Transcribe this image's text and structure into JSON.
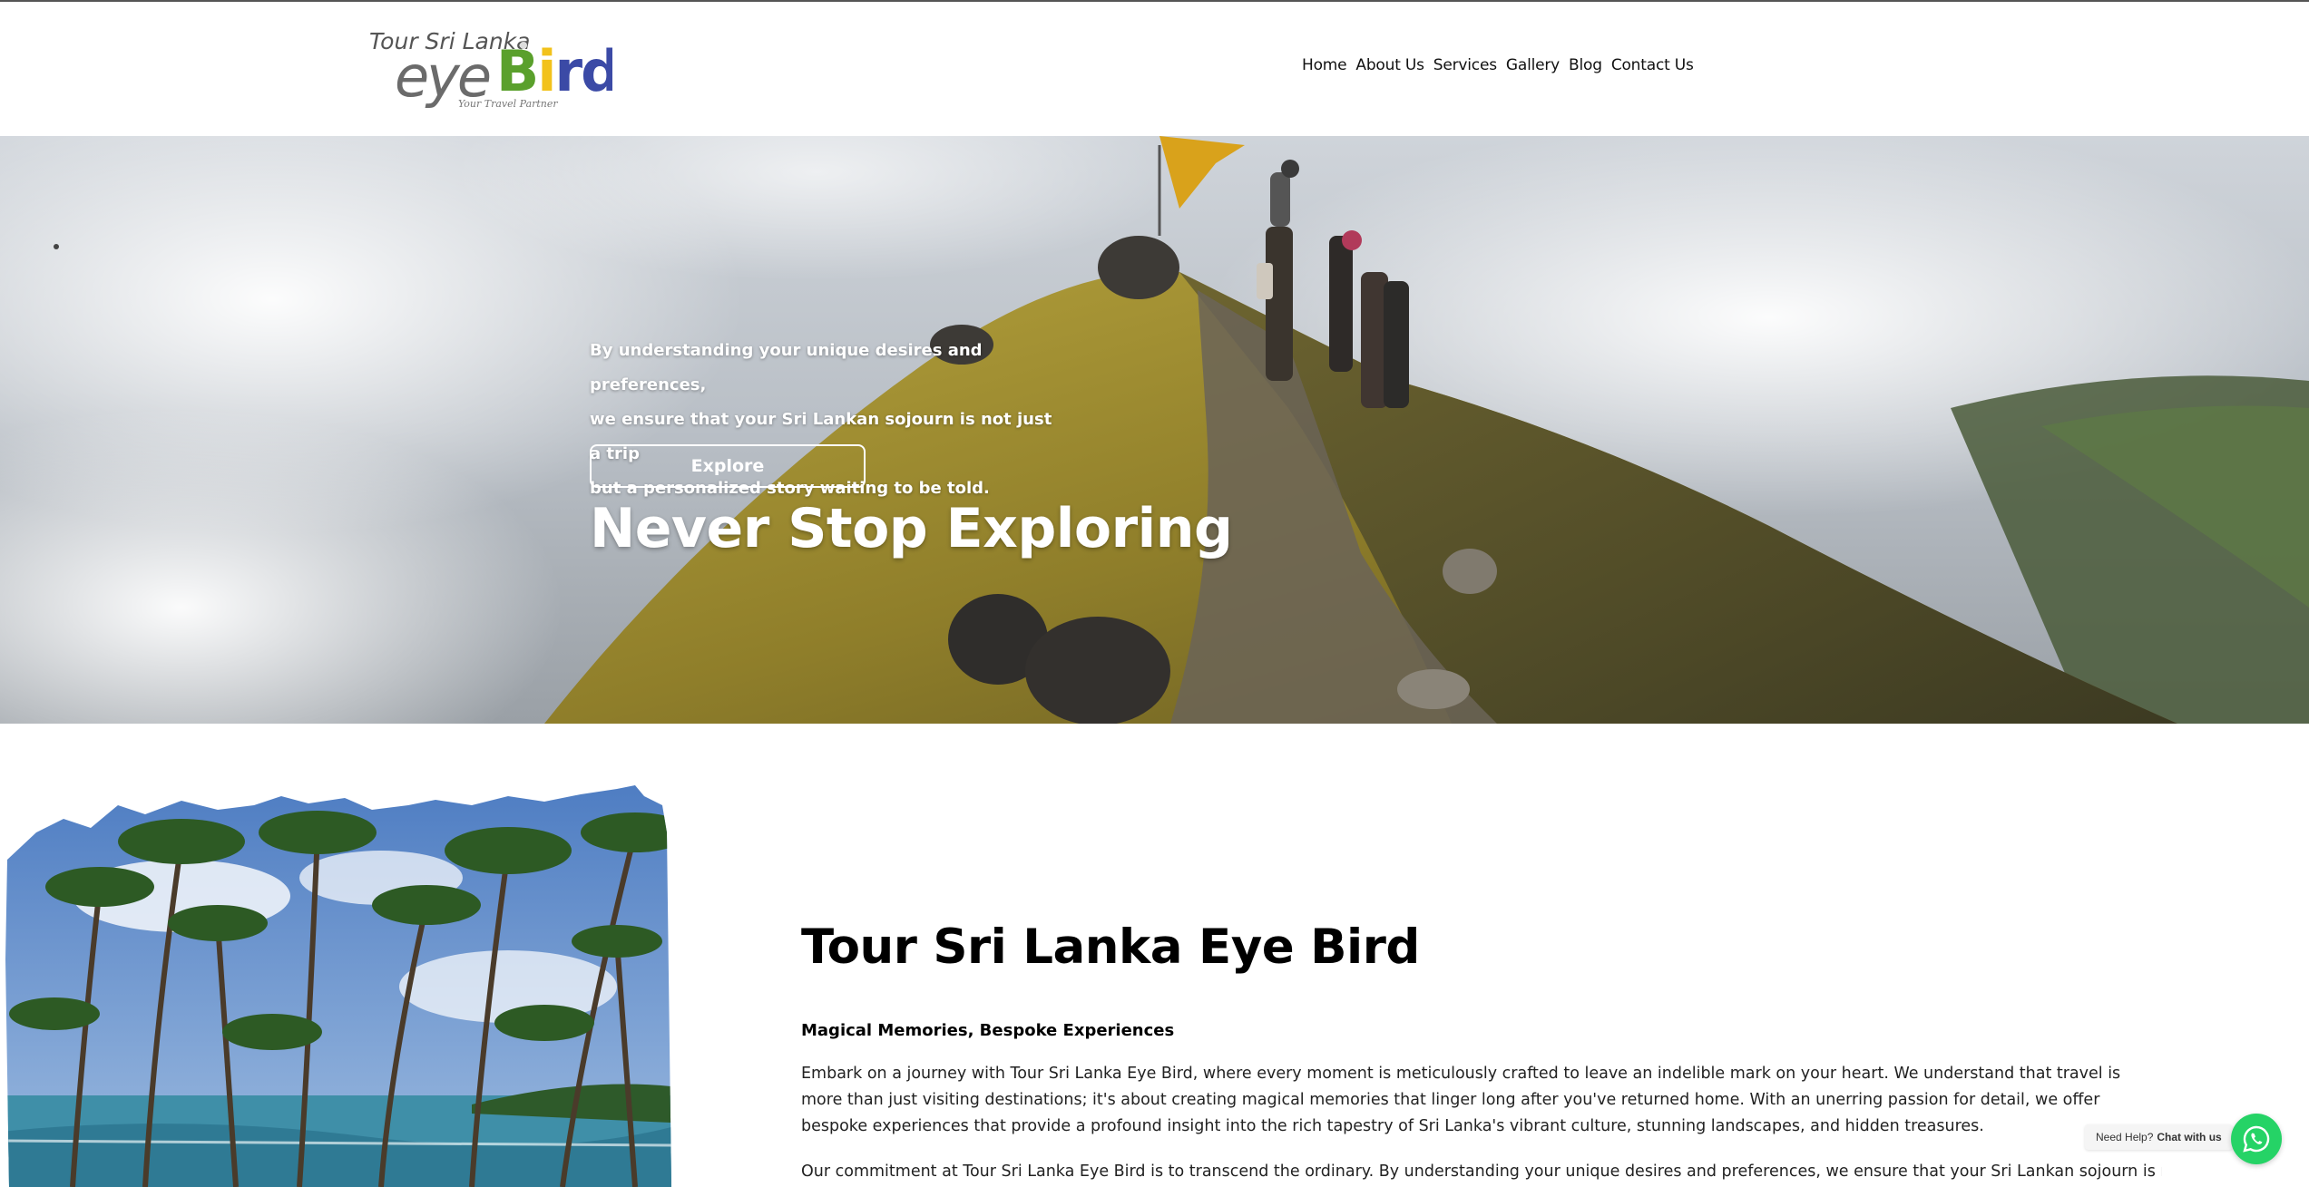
{
  "logo": {
    "line1": "Tour Sri Lanka",
    "eye": "eye",
    "bird": "Bird",
    "tagline": "Your Travel Partner"
  },
  "nav": {
    "items": [
      "Home",
      "About Us",
      "Services",
      "Gallery",
      "Blog",
      "Contact Us"
    ]
  },
  "hero": {
    "line1": "By understanding your unique desires and preferences,",
    "line2": "we ensure that your Sri Lankan sojourn is not just a trip",
    "line3": "but a personalized story waiting to be told.",
    "button_label": "Explore",
    "title": "Never Stop Exploring"
  },
  "about": {
    "title": "Tour Sri Lanka Eye Bird",
    "subtitle": "Magical Memories, Bespoke Experiences",
    "p1": "Embark on a journey with Tour Sri Lanka Eye Bird, where every moment is meticulously crafted to leave an indelible mark on your heart. We understand that travel is more than just visiting destinations; it's about creating magical memories that linger long after you've returned home. With an unerring passion for detail, we offer bespoke experiences that provide a profound insight into the rich tapestry of Sri Lanka's vibrant culture, stunning landscapes, and hidden treasures.",
    "p2": "Our commitment at Tour Sri Lanka Eye Bird is to transcend the ordinary. By understanding your unique desires and preferences, we ensure that your Sri Lankan sojourn is not just a trip but a"
  },
  "whatsapp": {
    "prefix": "Need Help?",
    "label": "Chat with us",
    "icon": "whatsapp-icon",
    "color": "#25d366"
  },
  "colors": {
    "logo_green": "#5aa02c",
    "logo_yellow": "#f2c21b",
    "logo_blue": "#3b4aa6"
  }
}
